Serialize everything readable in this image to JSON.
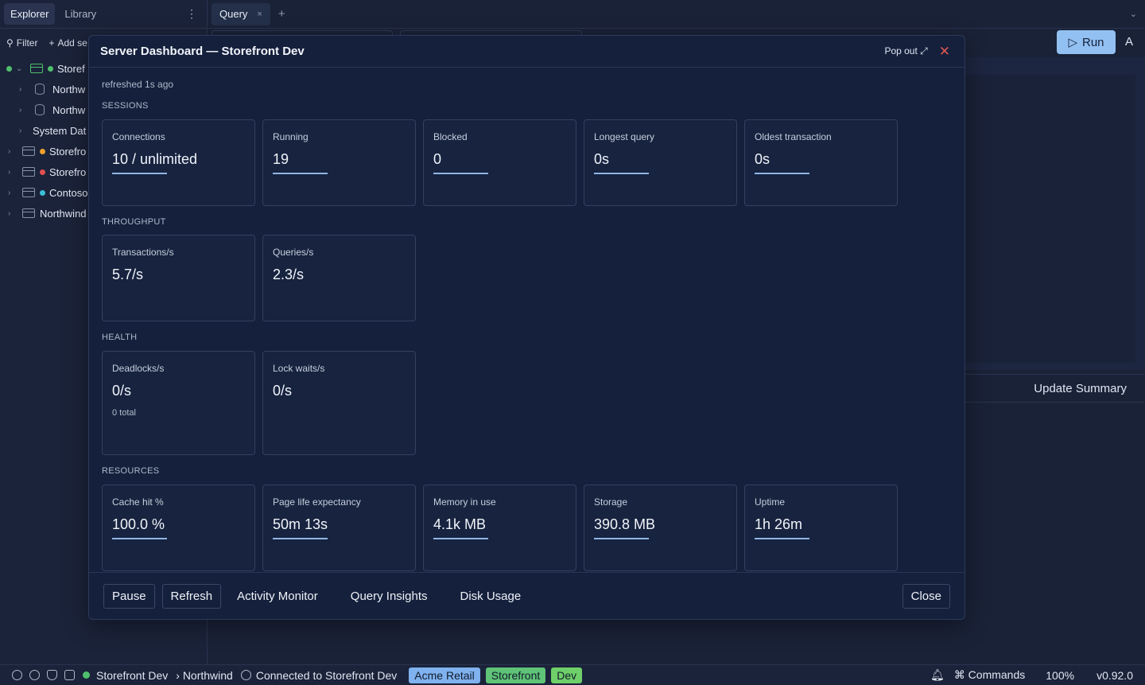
{
  "sidebar": {
    "tabs": [
      "Explorer",
      "Library"
    ],
    "toolbar": {
      "filter_label": "Filter",
      "add_label": "Add se"
    },
    "tree": [
      {
        "label": "Storef",
        "color": "#4fbf6b"
      },
      {
        "label": "Northw"
      },
      {
        "label": "Northw"
      },
      {
        "label": "System Dat"
      },
      {
        "label": "Storefro",
        "color": "#f0a030"
      },
      {
        "label": "Storefro",
        "color": "#e05050"
      },
      {
        "label": "Contoso",
        "color": "#3cc0d8"
      },
      {
        "label": "Northwind"
      }
    ]
  },
  "tabbar": {
    "query_tab": "Query",
    "close_glyph": "×",
    "plus_glyph": "+"
  },
  "editor": {
    "run_label": "Run",
    "a_label": "A",
    "update_summary": "Update Summary"
  },
  "modal": {
    "title": "Server Dashboard — Storefront Dev",
    "popout_label": "Pop out ⤢",
    "refreshed": "refreshed 1s ago",
    "sections": {
      "sessions": "SESSIONS",
      "throughput": "THROUGHPUT",
      "health": "HEALTH",
      "resources": "RESOURCES"
    },
    "sessions": [
      {
        "label": "Connections",
        "value": "10 / unlimited"
      },
      {
        "label": "Running",
        "value": "19"
      },
      {
        "label": "Blocked",
        "value": "0"
      },
      {
        "label": "Longest query",
        "value": "0s"
      },
      {
        "label": "Oldest transaction",
        "value": "0s"
      }
    ],
    "throughput": [
      {
        "label": "Transactions/s",
        "value": "5.7/s"
      },
      {
        "label": "Queries/s",
        "value": "2.3/s"
      }
    ],
    "health": [
      {
        "label": "Deadlocks/s",
        "value": "0/s",
        "sub": "0 total"
      },
      {
        "label": "Lock waits/s",
        "value": "0/s"
      }
    ],
    "resources": [
      {
        "label": "Cache hit %",
        "value": "100.0 %"
      },
      {
        "label": "Page life expectancy",
        "value": "50m 13s"
      },
      {
        "label": "Memory in use",
        "value": "4.1k MB"
      },
      {
        "label": "Storage",
        "value": "390.8 MB"
      },
      {
        "label": "Uptime",
        "value": "1h 26m"
      }
    ],
    "footer": {
      "pause": "Pause",
      "refresh": "Refresh",
      "activity_monitor": "Activity Monitor",
      "query_insights": "Query Insights",
      "disk_usage": "Disk Usage",
      "close": "Close"
    }
  },
  "statusbar": {
    "connection": "Storefront Dev",
    "database": "› Northwind",
    "connected_text": "Connected to Storefront Dev",
    "badges": [
      {
        "label": "Acme Retail",
        "color": "#7fb2ef"
      },
      {
        "label": "Storefront",
        "color": "#5fc477"
      },
      {
        "label": "Dev",
        "color": "#6fd06a"
      }
    ],
    "commands": "⌘ Commands",
    "zoom": "100%",
    "version": "v0.92.0"
  }
}
